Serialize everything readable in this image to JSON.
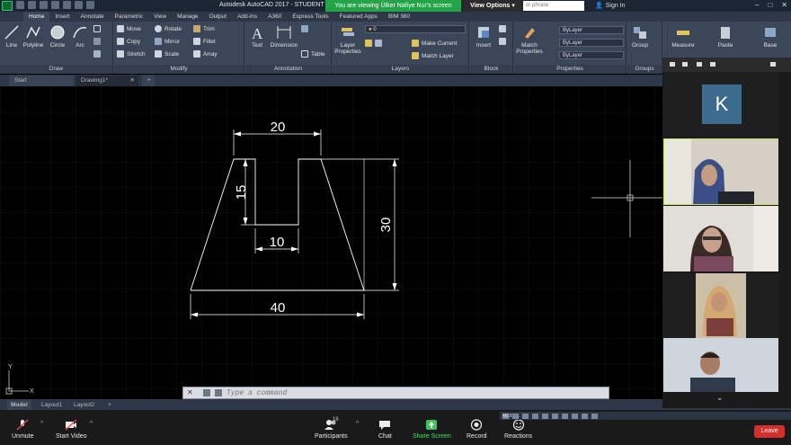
{
  "titlebar": {
    "title": "Autodesk AutoCAD 2017 - STUDENT V",
    "share_banner": "You are viewing Ülker Nafiye Nur's screen",
    "view_options": "View Options",
    "search_placeholder": "or phrase",
    "signin": "Sign In"
  },
  "ribbon_tabs": [
    "Home",
    "Insert",
    "Annotate",
    "Parametric",
    "View",
    "Manage",
    "Output",
    "Add-ins",
    "A360",
    "Express Tools",
    "Featured Apps",
    "BIM 360"
  ],
  "ribbon": {
    "draw": {
      "title": "Draw",
      "line": "Line",
      "polyline": "Polyline",
      "circle": "Circle",
      "arc": "Arc"
    },
    "modify": {
      "title": "Modify",
      "move": "Move",
      "rotate": "Rotate",
      "trim": "Trim",
      "copy": "Copy",
      "mirror": "Mirror",
      "fillet": "Fillet",
      "stretch": "Stretch",
      "scale": "Scale",
      "array": "Array"
    },
    "annotation": {
      "title": "Annotation",
      "text": "Text",
      "dimension": "Dimension",
      "table": "Table"
    },
    "layers": {
      "title": "Layers",
      "layer_properties_1": "Layer",
      "layer_properties_2": "Properties",
      "layer_value": "0",
      "make_current": "Make Current",
      "match_layer": "Match Layer"
    },
    "block": {
      "title": "Block",
      "insert": "Insert"
    },
    "properties": {
      "title": "Properties",
      "match_1": "Match",
      "match_2": "Properties",
      "bylayer_1": "ByLayer",
      "bylayer_2": "ByLayer",
      "bylayer_3": "ByLayer"
    },
    "groups": {
      "title": "Groups",
      "group": "Group"
    },
    "utilities": {
      "measure": "Measure"
    },
    "clipboard": {
      "paste": "Paste"
    },
    "view": {
      "base": "Base"
    }
  },
  "file_tabs": {
    "start": "Start",
    "drawing": "Drawing1*"
  },
  "drawing": {
    "dimensions": {
      "top": "20",
      "left_depth": "15",
      "inner_width": "10",
      "height": "30",
      "bottom": "40"
    },
    "ucs_x": "X",
    "ucs_y": "Y"
  },
  "command_line": {
    "placeholder": "Type a command",
    "close": "✕"
  },
  "layout_tabs": {
    "model": "Model",
    "layout1": "Layout1",
    "layout2": "Layout2",
    "plus": "+"
  },
  "status_bar": {
    "model": "MODEL"
  },
  "zoom_panel": {
    "avatar_letter": "K",
    "chevron": "⌄"
  },
  "zoom_toolbar": {
    "unmute": "Unmute",
    "start_video": "Start Video",
    "participants": "Participants",
    "participants_count": "18",
    "chat": "Chat",
    "share_screen": "Share Screen",
    "record": "Record",
    "reactions": "Reactions",
    "leave": "Leave"
  }
}
